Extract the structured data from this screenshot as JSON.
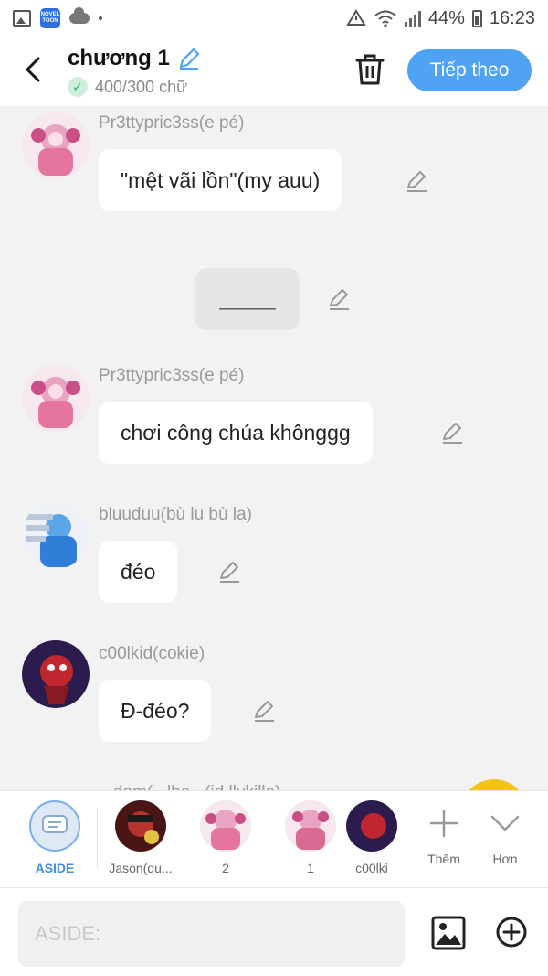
{
  "status_bar": {
    "app_icon_text": "NOVEL TOON",
    "battery": "44%",
    "time": "16:23"
  },
  "header": {
    "title": "chương 1",
    "word_count": "400/300 chữ",
    "next_label": "Tiếp theo"
  },
  "messages": [
    {
      "type": "character",
      "sender": "Pr3ttypric3ss(e pé)",
      "text": "\"mệt vãi lồn\"(my auu)",
      "avatar": "pink-girl"
    },
    {
      "type": "aside",
      "text": "_____"
    },
    {
      "type": "character",
      "sender": "Pr3ttypric3ss(e pé)",
      "text": "chơi công chúa khônggg",
      "avatar": "pink-girl"
    },
    {
      "type": "character",
      "sender": "bluuduu(bù lu bù la)",
      "text": "đéo",
      "avatar": "blue-boy"
    },
    {
      "type": "character",
      "sender": "c00lkid(cokie)",
      "text": "Đ-đéo?",
      "avatar": "red-kid"
    }
  ],
  "partial_sender": "...dom(...lhe...(id llykilla)",
  "characters": [
    {
      "label": "ASIDE",
      "avatar": "aside"
    },
    {
      "label": "Jason(qu...",
      "avatar": "jason"
    },
    {
      "label": "2",
      "avatar": "pink-girl"
    },
    {
      "label": "1",
      "avatar": "pink-girl-2"
    },
    {
      "label": "c00lki",
      "avatar": "red-kid"
    }
  ],
  "tools": {
    "more_label": "Thêm",
    "less_label": "Hơn"
  },
  "input": {
    "placeholder": "ASIDE:",
    "value": ""
  },
  "colors": {
    "accent": "#4fa3f2",
    "background": "#f2f2f2",
    "success": "#2bb56c"
  }
}
